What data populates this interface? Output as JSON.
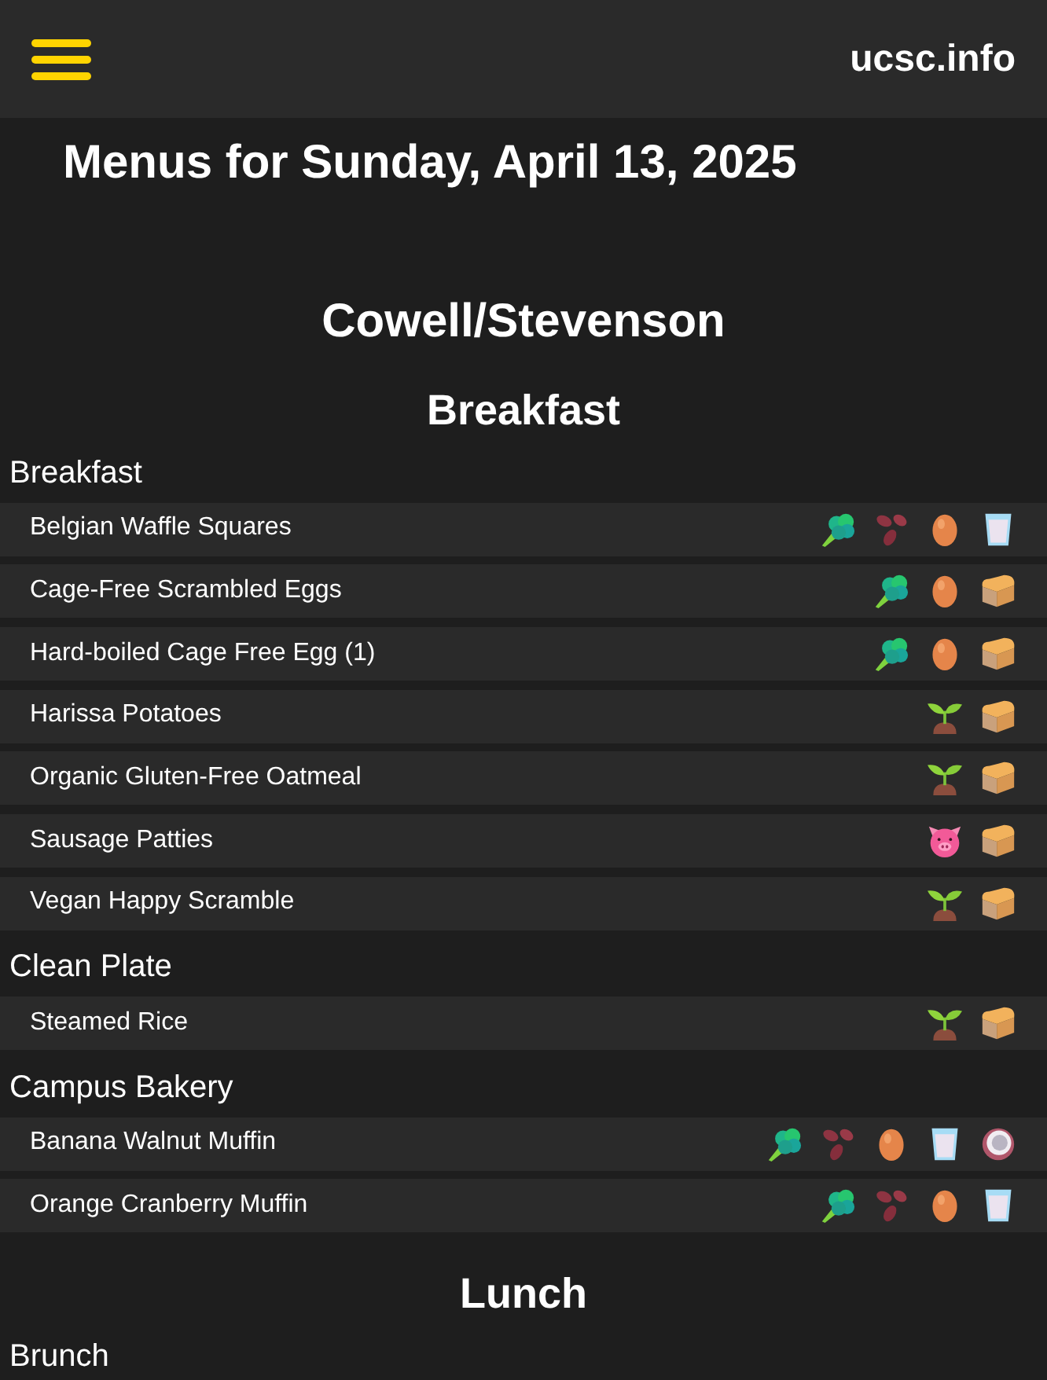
{
  "header": {
    "site_title": "ucsc.info"
  },
  "page_title": "Menus for Sunday, April 13, 2025",
  "dining_halls": [
    {
      "name": "Cowell/Stevenson",
      "meals": [
        {
          "name": "Breakfast",
          "categories": [
            {
              "name": "Breakfast",
              "items": [
                {
                  "name": "Belgian Waffle Squares",
                  "icons": [
                    {
                      "kind": "broccoli"
                    },
                    {
                      "kind": "beans"
                    },
                    {
                      "kind": "egg"
                    },
                    {
                      "kind": "milk"
                    }
                  ]
                },
                {
                  "name": "Cage-Free Scrambled Eggs",
                  "icons": [
                    {
                      "kind": "broccoli"
                    },
                    {
                      "kind": "egg"
                    },
                    {
                      "kind": "bread"
                    }
                  ]
                },
                {
                  "name": "Hard-boiled Cage Free Egg (1)",
                  "icons": [
                    {
                      "kind": "broccoli"
                    },
                    {
                      "kind": "egg"
                    },
                    {
                      "kind": "bread"
                    }
                  ]
                },
                {
                  "name": "Harissa Potatoes",
                  "icons": [
                    {
                      "kind": "seedling"
                    },
                    {
                      "kind": "bread"
                    }
                  ]
                },
                {
                  "name": "Organic Gluten-Free Oatmeal",
                  "icons": [
                    {
                      "kind": "seedling"
                    },
                    {
                      "kind": "bread"
                    }
                  ]
                },
                {
                  "name": "Sausage Patties",
                  "icons": [
                    {
                      "kind": "pig"
                    },
                    {
                      "kind": "bread"
                    }
                  ]
                },
                {
                  "name": "Vegan Happy Scramble",
                  "icons": [
                    {
                      "kind": "seedling"
                    },
                    {
                      "kind": "bread"
                    }
                  ]
                }
              ]
            },
            {
              "name": "Clean Plate",
              "items": [
                {
                  "name": "Steamed Rice",
                  "icons": [
                    {
                      "kind": "seedling"
                    },
                    {
                      "kind": "bread"
                    }
                  ]
                }
              ]
            },
            {
              "name": "Campus Bakery",
              "items": [
                {
                  "name": "Banana Walnut Muffin",
                  "icons": [
                    {
                      "kind": "broccoli"
                    },
                    {
                      "kind": "beans"
                    },
                    {
                      "kind": "egg"
                    },
                    {
                      "kind": "milk"
                    },
                    {
                      "kind": "coconut"
                    }
                  ]
                },
                {
                  "name": "Orange Cranberry Muffin",
                  "icons": [
                    {
                      "kind": "broccoli"
                    },
                    {
                      "kind": "beans"
                    },
                    {
                      "kind": "egg"
                    },
                    {
                      "kind": "milk"
                    }
                  ]
                }
              ]
            }
          ]
        },
        {
          "name": "Lunch",
          "categories": [
            {
              "name": "Brunch"
            }
          ]
        }
      ]
    }
  ]
}
